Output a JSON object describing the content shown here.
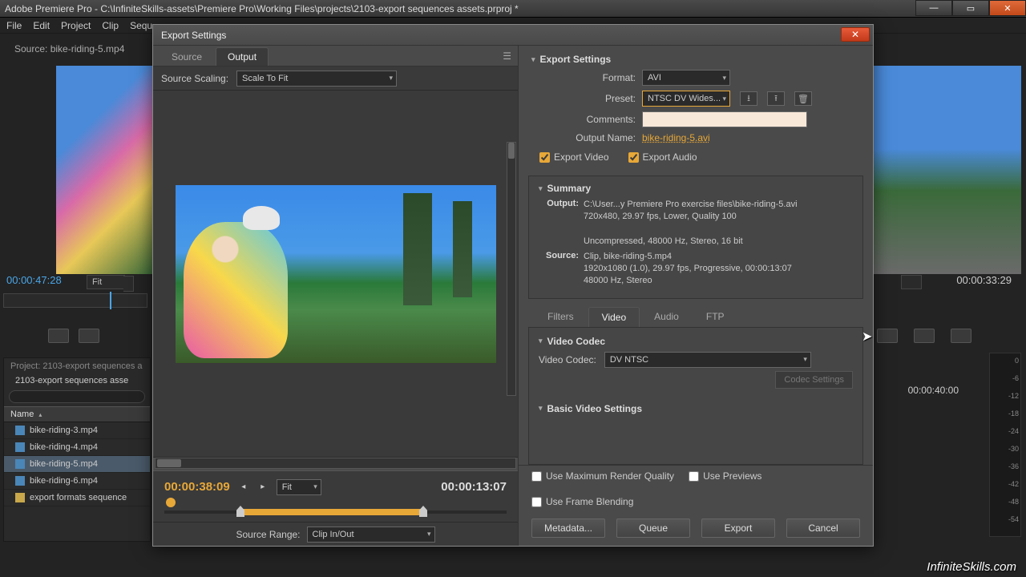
{
  "window": {
    "title": "Adobe Premiere Pro - C:\\InfiniteSkills-assets\\Premiere Pro\\Working Files\\projects\\2103-export sequences assets.prproj *"
  },
  "menubar": [
    "File",
    "Edit",
    "Project",
    "Clip",
    "Sequ"
  ],
  "background": {
    "source_tab": "Source: bike-riding-5.mp4",
    "tc_left": "00:00:47:28",
    "fit_left": "Fit",
    "tc_right": "00:00:33:29",
    "timeline_time": "00:00:40:00"
  },
  "project_panel": {
    "title": "Project: 2103-export sequences a",
    "name": "2103-export sequences asse",
    "col_header": "Name",
    "items": [
      {
        "label": "bike-riding-3.mp4",
        "type": "clip"
      },
      {
        "label": "bike-riding-4.mp4",
        "type": "clip"
      },
      {
        "label": "bike-riding-5.mp4",
        "type": "clip",
        "selected": true
      },
      {
        "label": "bike-riding-6.mp4",
        "type": "clip"
      },
      {
        "label": "export formats sequence",
        "type": "seq"
      }
    ]
  },
  "audio_meter_ticks": [
    "0",
    "-6",
    "-12",
    "-18",
    "-24",
    "-30",
    "-36",
    "-42",
    "-48",
    "-54"
  ],
  "dialog": {
    "title": "Export Settings",
    "preview": {
      "tabs": [
        "Source",
        "Output"
      ],
      "active_tab": "Output",
      "scaling_label": "Source Scaling:",
      "scaling_value": "Scale To Fit",
      "tc_in": "00:00:38:09",
      "fit": "Fit",
      "tc_dur": "00:00:13:07",
      "range_label": "Source Range:",
      "range_value": "Clip In/Out"
    },
    "export": {
      "header": "Export Settings",
      "format_label": "Format:",
      "format_value": "AVI",
      "preset_label": "Preset:",
      "preset_value": "NTSC DV Wides...",
      "comments_label": "Comments:",
      "comments_value": "",
      "output_label": "Output Name:",
      "output_value": "bike-riding-5.avi",
      "export_video": "Export Video",
      "export_audio": "Export Audio",
      "summary_head": "Summary",
      "summary_output_label": "Output:",
      "summary_output": "C:\\User...y Premiere Pro exercise files\\bike-riding-5.avi\n720x480, 29.97 fps, Lower, Quality 100\n\nUncompressed, 48000 Hz, Stereo, 16 bit",
      "summary_source_label": "Source:",
      "summary_source": "Clip, bike-riding-5.mp4\n1920x1080 (1.0), 29.97 fps, Progressive, 00:00:13:07\n48000 Hz, Stereo"
    },
    "settings": {
      "tabs": [
        "Filters",
        "Video",
        "Audio",
        "FTP"
      ],
      "active_tab": "Video",
      "video_codec_head": "Video Codec",
      "video_codec_label": "Video Codec:",
      "video_codec_value": "DV NTSC",
      "codec_settings_btn": "Codec Settings",
      "basic_head": "Basic Video Settings"
    },
    "bottom": {
      "max_quality": "Use Maximum Render Quality",
      "previews": "Use Previews",
      "frame_blend": "Use Frame Blending",
      "buttons": [
        "Metadata...",
        "Queue",
        "Export",
        "Cancel"
      ]
    }
  },
  "watermark": "InfiniteSkills.com"
}
